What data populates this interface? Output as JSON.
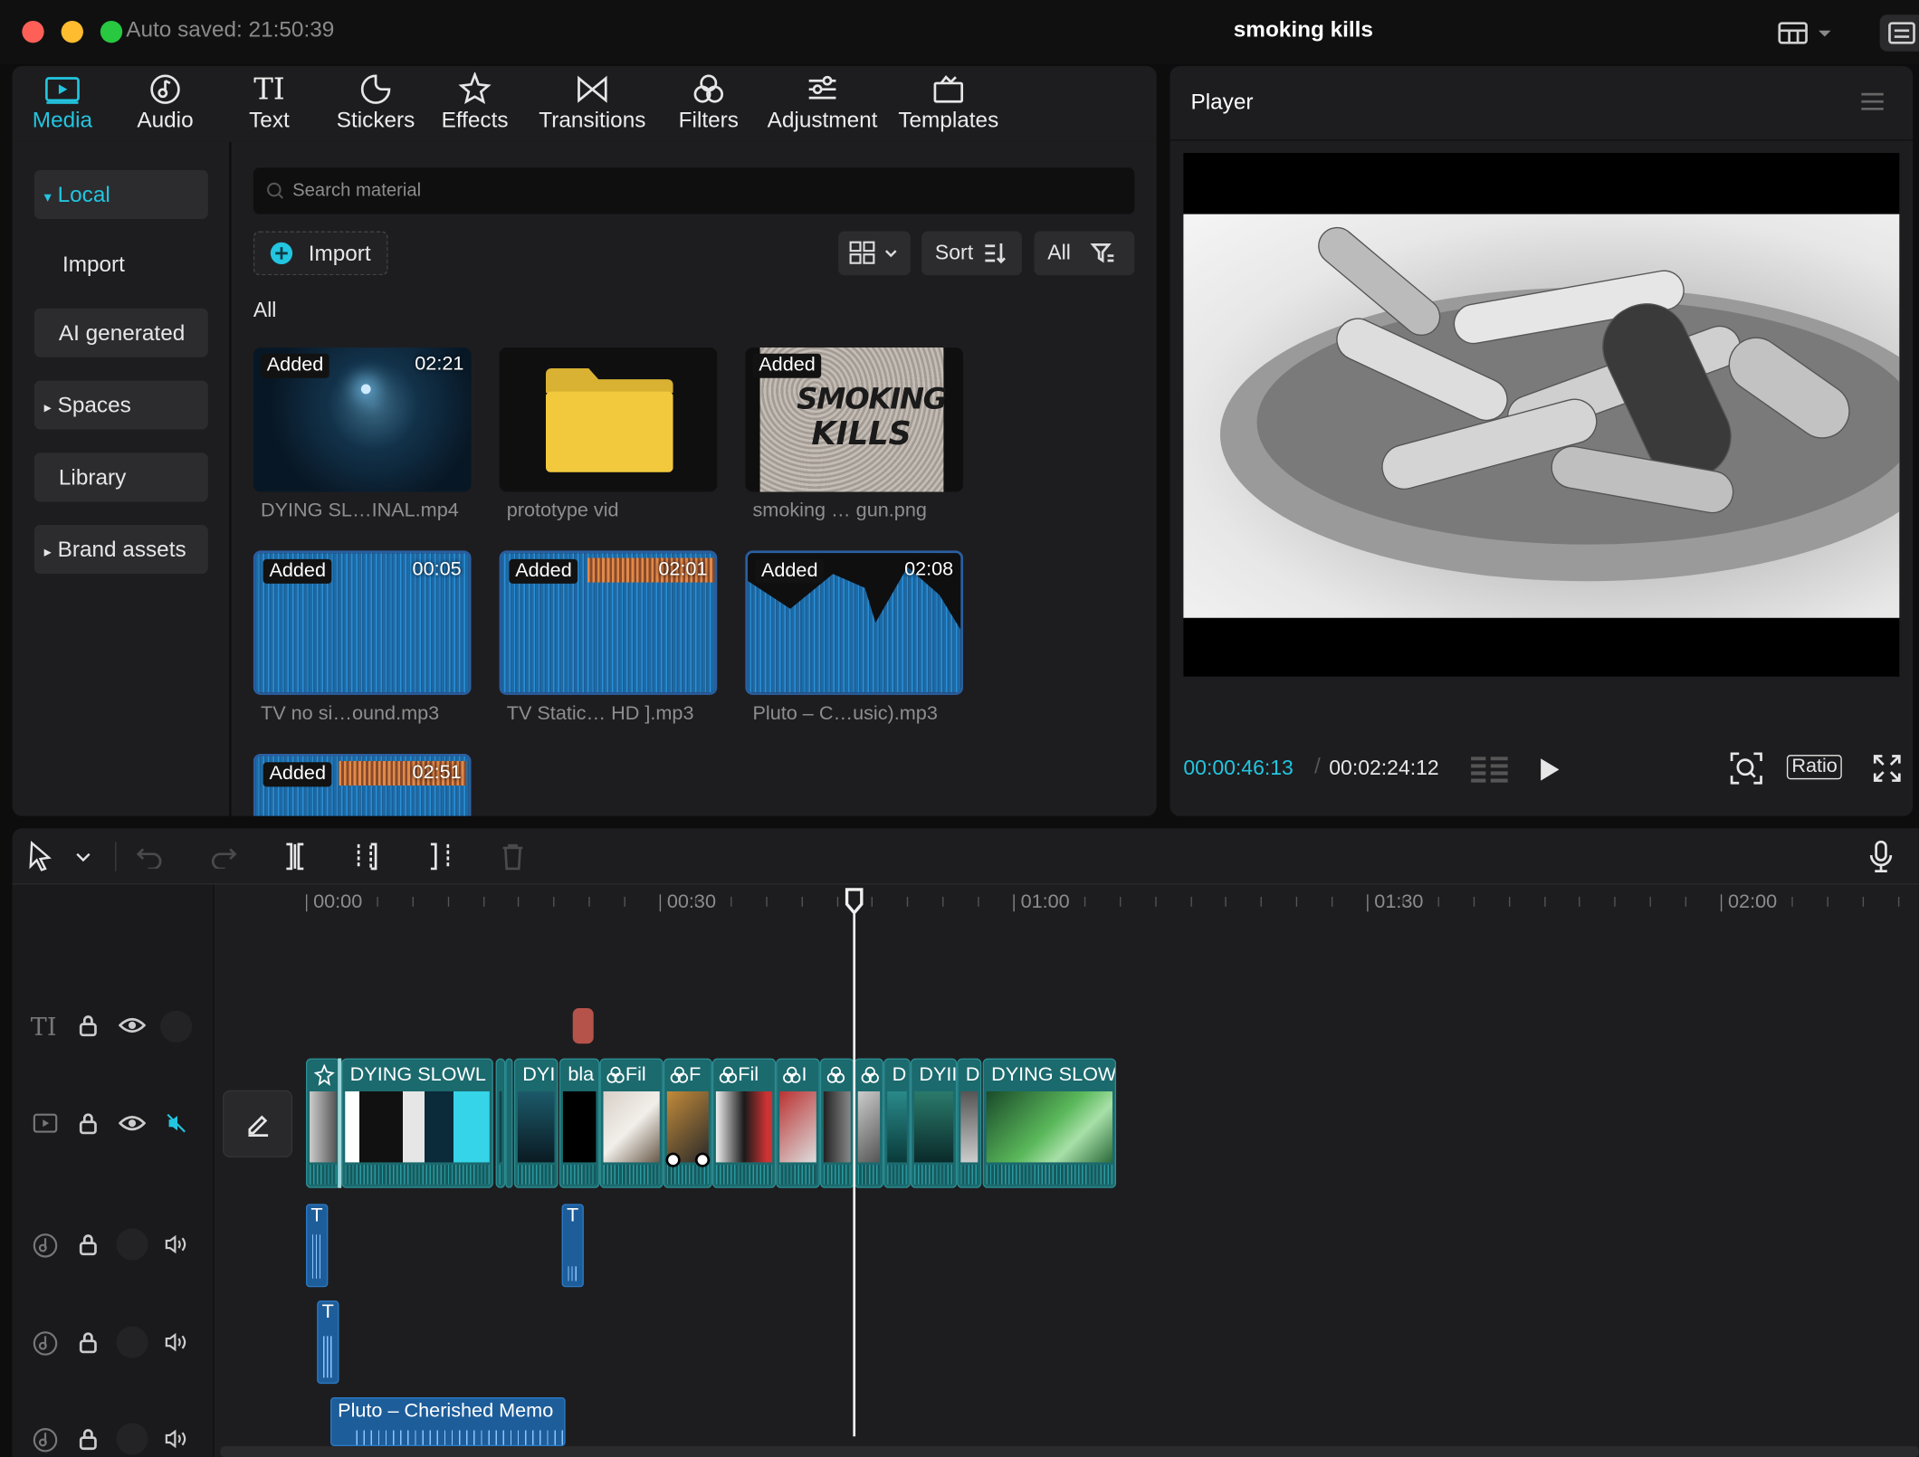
{
  "window": {
    "autosave": "Auto saved: 21:50:39",
    "title": "smoking kills"
  },
  "tabs": [
    {
      "label": "Media",
      "icon": "media-icon",
      "active": true
    },
    {
      "label": "Audio",
      "icon": "audio-icon"
    },
    {
      "label": "Text",
      "icon": "text-icon",
      "glyph": "TI"
    },
    {
      "label": "Stickers",
      "icon": "sticker-icon"
    },
    {
      "label": "Effects",
      "icon": "effects-icon"
    },
    {
      "label": "Transitions",
      "icon": "transitions-icon"
    },
    {
      "label": "Filters",
      "icon": "filters-icon"
    },
    {
      "label": "Adjustment",
      "icon": "adjustment-icon"
    },
    {
      "label": "Templates",
      "icon": "templates-icon"
    }
  ],
  "sidebar": {
    "items": [
      {
        "label": "Local",
        "active": true,
        "arrow": "▾"
      },
      {
        "label": "Import"
      },
      {
        "label": "AI generated"
      },
      {
        "label": "Spaces",
        "arrow": "▸"
      },
      {
        "label": "Library"
      },
      {
        "label": "Brand assets",
        "arrow": "▸"
      }
    ]
  },
  "media": {
    "search_placeholder": "Search material",
    "import_label": "Import",
    "sort_label": "Sort",
    "all_filter_label": "All",
    "section_label": "All",
    "items": [
      {
        "badge": "Added",
        "duration": "02:21",
        "caption": "DYING SL…INAL.mp4",
        "kind": "video"
      },
      {
        "badge": "",
        "duration": "",
        "caption": "prototype vid",
        "kind": "folder"
      },
      {
        "badge": "Added",
        "duration": "",
        "caption": "smoking … gun.png",
        "kind": "image",
        "art_text_1": "SMOKING",
        "art_text_2": "KILLS"
      },
      {
        "badge": "Added",
        "duration": "00:05",
        "caption": "TV no si…ound.mp3",
        "kind": "audio"
      },
      {
        "badge": "Added",
        "duration": "02:01",
        "caption": "TV Static… HD ].mp3",
        "kind": "audio"
      },
      {
        "badge": "Added",
        "duration": "02:08",
        "caption": "Pluto – C…usic).mp3",
        "kind": "audio"
      },
      {
        "badge": "Added",
        "duration": "02:51",
        "caption": "",
        "kind": "audio"
      }
    ]
  },
  "player": {
    "title": "Player",
    "current_time": "00:00:46:13",
    "total_time": "00:02:24:12",
    "ratio_label": "Ratio"
  },
  "timeline": {
    "ruler": [
      "00:00",
      "00:30",
      "01:00",
      "01:30",
      "02:00"
    ],
    "playhead_time": "00:46",
    "text_track_glyph": "TI",
    "clips": [
      {
        "label": "DYING SLOWL"
      },
      {
        "label": "DYI"
      },
      {
        "label": "bla"
      },
      {
        "label": "Fil"
      },
      {
        "label": "F"
      },
      {
        "label": "Fil"
      },
      {
        "label": "I"
      },
      {
        "label": "D"
      },
      {
        "label": "DYII"
      },
      {
        "label": "D"
      },
      {
        "label": "DYING SLOW"
      }
    ],
    "audio_clip_label": "Pluto – Cherished Memo",
    "small_audio_label": "T"
  },
  "colors": {
    "accent": "#23c5e0",
    "clip": "#1b6a6e",
    "audio": "#1d5d9a",
    "marker": "#b5534a"
  }
}
